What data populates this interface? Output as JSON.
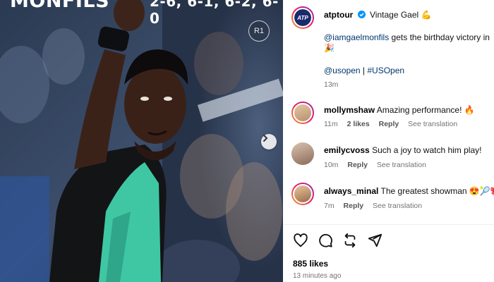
{
  "media": {
    "overlay_name": "MONFILS",
    "overlay_score": "2-6, 6-1, 6-2, 6-0",
    "round_badge": "R1",
    "next_icon": "chevron-right-icon"
  },
  "post": {
    "author": "atptour",
    "verified_icon": "verified-badge-icon",
    "caption_title": "Vintage Gael 💪",
    "mention": "@iamgaelmonfils",
    "caption_text": " gets the birthday victory in",
    "caption_emoji": "🎉",
    "tag_account": "@usopen",
    "tag_separator": " | ",
    "hashtag": "#USOpen",
    "time": "13m",
    "logo_text": "ATP"
  },
  "comments": [
    {
      "user": "mollymshaw",
      "text": "Amazing performance! 🔥",
      "time": "11m",
      "likes": "2 likes",
      "reply": "Reply",
      "translate": "See translation"
    },
    {
      "user": "emilycvoss",
      "text": "Such a joy to watch him play!",
      "time": "10m",
      "likes": "",
      "reply": "Reply",
      "translate": "See translation"
    },
    {
      "user": "always_minal",
      "text": "The greatest showman 😍🎾🎀",
      "time": "7m",
      "likes": "",
      "reply": "Reply",
      "translate": "See translation"
    }
  ],
  "footer": {
    "likes": "885 likes",
    "time": "13 minutes ago",
    "icons": [
      "heart-icon",
      "comment-icon",
      "repost-icon",
      "share-icon"
    ]
  },
  "colors": {
    "link": "#00376b",
    "meta": "#737373",
    "shirt": "#3fc7a4"
  }
}
